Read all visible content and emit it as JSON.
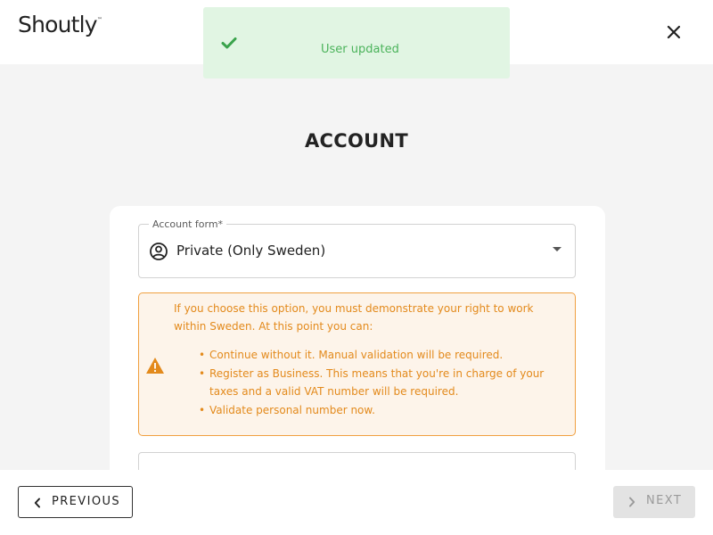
{
  "header": {
    "logo_text": "Shoutly",
    "logo_mark": "™",
    "close_icon": "close-icon"
  },
  "toast": {
    "icon": "check-icon",
    "message": "User updated",
    "color": "#4bb35b"
  },
  "page": {
    "title": "ACCOUNT"
  },
  "account_form": {
    "label": "Account form*",
    "icon": "account-circle-icon",
    "value": "Private (Only Sweden)"
  },
  "warning": {
    "icon": "warning-icon",
    "intro": "If you choose this option, you must demonstrate your right to work within Sweden. At this point you can:",
    "items": [
      "Continue without it. Manual validation will be required.",
      "Register as Business. This means that you're in charge of your taxes and a valid VAT number will be required.",
      "Validate personal number now."
    ],
    "color": "#e38a1c"
  },
  "footer": {
    "previous_label": "PREVIOUS",
    "next_label": "NEXT"
  }
}
